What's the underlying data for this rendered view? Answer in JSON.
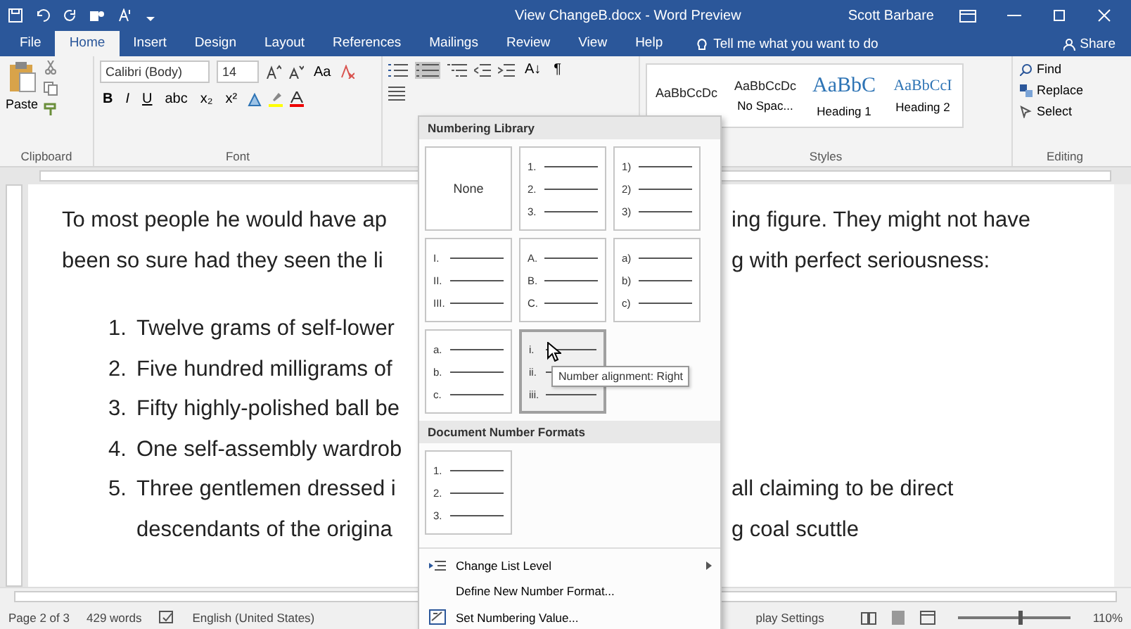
{
  "window": {
    "title": "View ChangeB.docx - Word Preview",
    "user": "Scott Barbare"
  },
  "tabs": [
    {
      "label": "File",
      "selected": false
    },
    {
      "label": "Home",
      "selected": true
    },
    {
      "label": "Insert",
      "selected": false
    },
    {
      "label": "Design",
      "selected": false
    },
    {
      "label": "Layout",
      "selected": false
    },
    {
      "label": "References",
      "selected": false
    },
    {
      "label": "Mailings",
      "selected": false
    },
    {
      "label": "Review",
      "selected": false
    },
    {
      "label": "View",
      "selected": false
    },
    {
      "label": "Help",
      "selected": false
    }
  ],
  "tell_me": {
    "placeholder": "Tell me what you want to do"
  },
  "share": "Share",
  "ribbon": {
    "clipboard": {
      "paste": "Paste",
      "label": "Clipboard"
    },
    "font": {
      "name": "Calibri (Body)",
      "size": "14",
      "case": "Aa",
      "format_buttons": [
        "B",
        "I",
        "U",
        "abc",
        "x₂",
        "x²"
      ],
      "label": "Font"
    },
    "paragraph": {
      "numbering_pressed": true,
      "sort": "A↓",
      "pilcrow": "¶"
    },
    "styles": {
      "items": [
        {
          "preview": "AaBbCcDc",
          "kind": "body"
        },
        {
          "preview": "AaBbCcDc",
          "name": "No Spac...",
          "kind": "body"
        },
        {
          "preview": "AaBbC",
          "name": "Heading 1",
          "kind": "heading1"
        },
        {
          "preview": "AaBbCcI",
          "name": "Heading 2",
          "kind": "heading2"
        }
      ],
      "label": "Styles"
    },
    "editing": {
      "items": [
        "Find",
        "Replace",
        "Select"
      ],
      "label": "Editing"
    }
  },
  "document": {
    "paragraph": [
      {
        "left": "To most people he would have ap",
        "right": "ing figure. They might not have"
      },
      {
        "left": "been so sure had they seen the li",
        "right": "g with perfect seriousness:"
      }
    ],
    "list": [
      {
        "number": "1.",
        "lines": [
          {
            "left": "Twelve grams of self-lower"
          }
        ]
      },
      {
        "number": "2.",
        "lines": [
          {
            "left": "Five hundred milligrams of"
          }
        ]
      },
      {
        "number": "3.",
        "lines": [
          {
            "left": "Fifty highly-polished ball be"
          }
        ]
      },
      {
        "number": "4.",
        "lines": [
          {
            "left": "One self-assembly wardrob"
          }
        ]
      },
      {
        "number": "5.",
        "lines": [
          {
            "left": "Three gentlemen dressed i",
            "right": "all claiming to be direct"
          },
          {
            "left": "descendants of the origina",
            "right": "g coal scuttle"
          }
        ]
      }
    ]
  },
  "numbering_menu": {
    "library_title": "Numbering Library",
    "library": [
      {
        "kind": "none",
        "label": "None",
        "selected": false
      },
      {
        "kind": "list",
        "markers": [
          "1.",
          "2.",
          "3."
        ],
        "selected": false
      },
      {
        "kind": "list",
        "markers": [
          "1)",
          "2)",
          "3)"
        ],
        "selected": false
      },
      {
        "kind": "list",
        "markers": [
          "I.",
          "II.",
          "III."
        ],
        "selected": false
      },
      {
        "kind": "list",
        "markers": [
          "A.",
          "B.",
          "C."
        ],
        "selected": false
      },
      {
        "kind": "list",
        "markers": [
          "a)",
          "b)",
          "c)"
        ],
        "selected": false
      },
      {
        "kind": "list",
        "markers": [
          "a.",
          "b.",
          "c."
        ],
        "selected": false
      },
      {
        "kind": "list",
        "markers": [
          "i.",
          "ii.",
          "iii."
        ],
        "selected": true
      }
    ],
    "tooltip": "Number alignment: Right",
    "document_title": "Document Number Formats",
    "document_formats": [
      {
        "kind": "list",
        "markers": [
          "1.",
          "2.",
          "3."
        ],
        "selected": false
      }
    ],
    "commands": [
      {
        "label": "Change List Level",
        "kind": "submenu"
      },
      {
        "label": "Define New Number Format...",
        "kind": "plain"
      },
      {
        "label": "Set Numbering Value...",
        "kind": "value"
      }
    ]
  },
  "status_bar": {
    "page": "Page 2 of 3",
    "words": "429 words",
    "language": "English (United States)",
    "display": "play Settings",
    "zoom_slider": {
      "level": 0.55
    },
    "zoom": "110%"
  }
}
